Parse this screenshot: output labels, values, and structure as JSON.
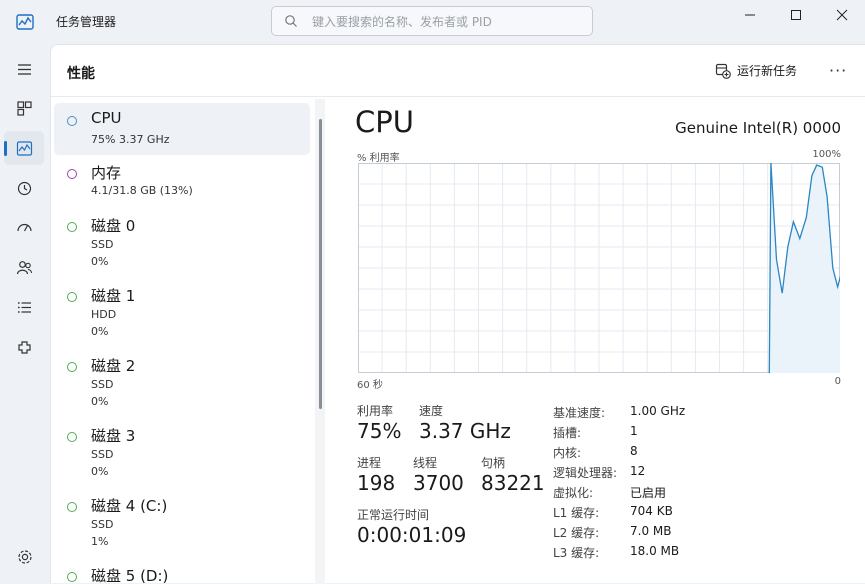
{
  "app": {
    "title": "任务管理器"
  },
  "search": {
    "placeholder": "键入要搜索的名称、发布者或 PID"
  },
  "header": {
    "title": "性能",
    "run_task": "运行新任务",
    "more": "···"
  },
  "nav": [
    "menu-icon",
    "processes-icon",
    "performance-icon",
    "history-icon",
    "startup-icon",
    "users-icon",
    "details-icon",
    "services-icon"
  ],
  "list": [
    {
      "title": "CPU",
      "sub1": "75%  3.37 GHz",
      "sub2": "",
      "color": "#4a90c8"
    },
    {
      "title": "内存",
      "sub1": "4.1/31.8 GB (13%)",
      "sub2": "",
      "color": "#a040b0"
    },
    {
      "title": "磁盘 0",
      "sub1": "SSD",
      "sub2": "0%",
      "color": "#4caf50"
    },
    {
      "title": "磁盘 1",
      "sub1": "HDD",
      "sub2": "0%",
      "color": "#4caf50"
    },
    {
      "title": "磁盘 2",
      "sub1": "SSD",
      "sub2": "0%",
      "color": "#4caf50"
    },
    {
      "title": "磁盘 3",
      "sub1": "SSD",
      "sub2": "0%",
      "color": "#4caf50"
    },
    {
      "title": "磁盘 4 (C:)",
      "sub1": "SSD",
      "sub2": "1%",
      "color": "#4caf50"
    },
    {
      "title": "磁盘 5 (D:)",
      "sub1": "",
      "sub2": "",
      "color": "#4caf50"
    }
  ],
  "detail": {
    "title": "CPU",
    "processor": "Genuine Intel(R) 0000",
    "graph_top_left": "% 利用率",
    "graph_top_right": "100%",
    "graph_bottom_left": "60 秒",
    "graph_bottom_right": "0",
    "utilization_label": "利用率",
    "utilization_value": "75%",
    "speed_label": "速度",
    "speed_value": "3.37 GHz",
    "processes_label": "进程",
    "processes_value": "198",
    "threads_label": "线程",
    "threads_value": "3700",
    "handles_label": "句柄",
    "handles_value": "83221",
    "uptime_label": "正常运行时间",
    "uptime_value": "0:00:01:09",
    "specs": [
      {
        "label": "基准速度:",
        "value": "1.00 GHz"
      },
      {
        "label": "插槽:",
        "value": "1"
      },
      {
        "label": "内核:",
        "value": "8"
      },
      {
        "label": "逻辑处理器:",
        "value": "12"
      },
      {
        "label": "虚拟化:",
        "value": "已启用"
      },
      {
        "label": "L1 缓存:",
        "value": "704 KB"
      },
      {
        "label": "L2 缓存:",
        "value": "7.0 MB"
      },
      {
        "label": "L3 缓存:",
        "value": "18.0 MB"
      }
    ]
  },
  "graph": {
    "x_range": [
      60,
      0
    ],
    "y_range": [
      0,
      100
    ],
    "line_color": "#2a86c4",
    "fill_color": "#eaf2fa",
    "points": [
      [
        8.8,
        0
      ],
      [
        8.6,
        100
      ],
      [
        7.9,
        54
      ],
      [
        7.2,
        38
      ],
      [
        6.5,
        60
      ],
      [
        5.8,
        72
      ],
      [
        5.0,
        64
      ],
      [
        4.2,
        74
      ],
      [
        3.5,
        94
      ],
      [
        2.9,
        99
      ],
      [
        2.2,
        98
      ],
      [
        1.6,
        84
      ],
      [
        0.9,
        50
      ],
      [
        0.3,
        41
      ],
      [
        -0.5,
        52
      ],
      [
        -1.3,
        75
      ],
      [
        -2.0,
        76
      ]
    ]
  },
  "colors": {
    "accent": "#1f6fc5"
  }
}
